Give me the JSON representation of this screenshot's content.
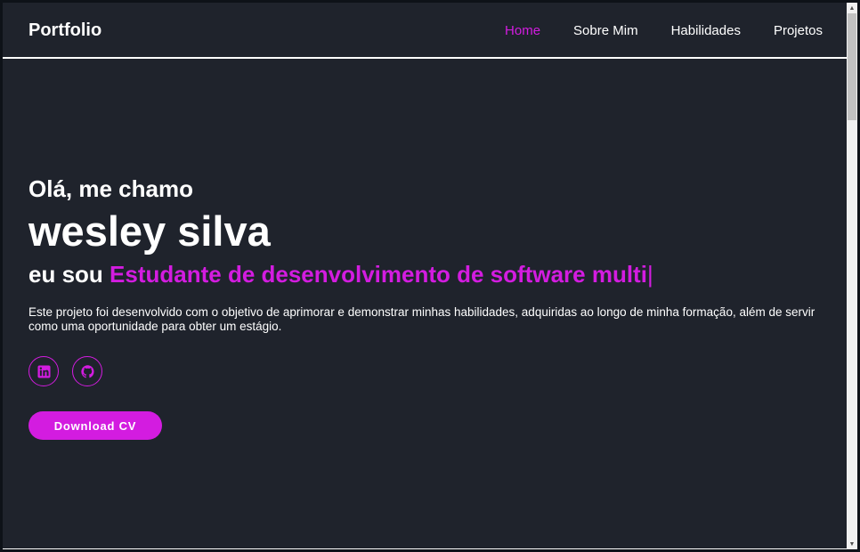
{
  "header": {
    "brand": "Portfolio",
    "nav": [
      {
        "label": "Home",
        "active": true
      },
      {
        "label": "Sobre Mim",
        "active": false
      },
      {
        "label": "Habilidades",
        "active": false
      },
      {
        "label": "Projetos",
        "active": false
      }
    ]
  },
  "hero": {
    "greeting": "Olá, me chamo",
    "name": "wesley silva",
    "role_prefix": "eu sou",
    "role_typed": "Estudante de desenvolvimento de software multi",
    "cursor": "|",
    "description": "Este projeto foi desenvolvido com o objetivo de aprimorar e demonstrar minhas habilidades, adquiridas ao longo de minha formação, além de servir como uma oportunidade para obter um estágio.",
    "socials": [
      {
        "icon": "linkedin-icon"
      },
      {
        "icon": "github-icon"
      }
    ],
    "download_label": "Download CV"
  },
  "colors": {
    "accent": "#d31ce0",
    "background": "#1f232c",
    "text": "#ffffff"
  }
}
